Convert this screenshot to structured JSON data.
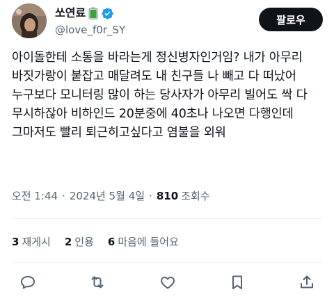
{
  "author": {
    "display_name": "쏘연료",
    "handle": "@love_f0r_SY",
    "avatar_icon": "profile-photo",
    "verified": true
  },
  "follow_button": {
    "label": "팔로우"
  },
  "tweet": {
    "text": "아이돌한테 소통을 바라는게 정신병자인거임? 내가 아무리 바짓가랑이 붙잡고 매달려도 내 친구들 나 빼고 다 떠났어 누구보다 모니터링 많이 하는 당사자가 아무리 빌어도 싹 다 무시하잖아 비하인드 20분중에 40초나 나오면 다행인데 그마저도 빨리 퇴근히고싶다고 염불을 외워"
  },
  "meta": {
    "time": "오전 1:44",
    "date": "2024년 5월 4일",
    "separator": "·",
    "views_count": "810",
    "views_label": "조회수"
  },
  "stats": {
    "reposts_count": "3",
    "reposts_label": "재게시",
    "quotes_count": "2",
    "quotes_label": "인용",
    "likes_count": "6",
    "likes_label": "마음에 들어요"
  },
  "actions": [
    "reply-icon",
    "repost-icon",
    "like-icon",
    "bookmark-icon",
    "share-icon"
  ],
  "colors": {
    "text": "#0f1419",
    "secondary": "#536471",
    "verified": "#1d9bf0",
    "follow_bg": "#0f1419",
    "divider": "#eff3f4",
    "battery": "#3aa63a"
  }
}
